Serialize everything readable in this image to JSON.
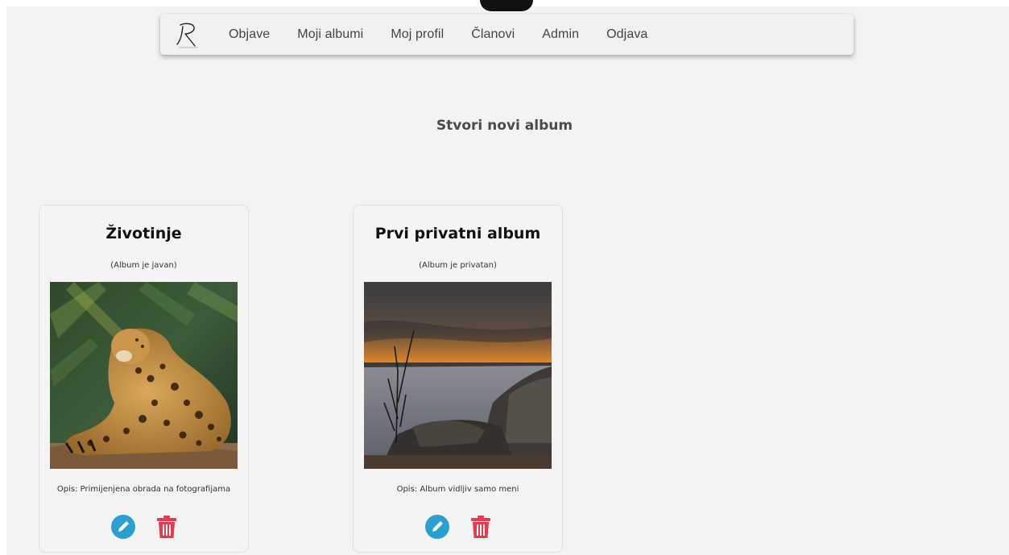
{
  "nav": {
    "logo_icon": "photographer-signature-logo",
    "items": [
      {
        "label": "Objave"
      },
      {
        "label": "Moji albumi"
      },
      {
        "label": "Moj profil"
      },
      {
        "label": "Članovi"
      },
      {
        "label": "Admin"
      },
      {
        "label": "Odjava"
      }
    ]
  },
  "main": {
    "create_album_label": "Stvori novi album"
  },
  "albums": [
    {
      "title": "Životinje",
      "visibility": "(Album je javan)",
      "cover_icon": "jaguar-photo",
      "description": "Opis: Primijenjena obrada na fotografijama"
    },
    {
      "title": "Prvi privatni album",
      "visibility": "(Album je privatan)",
      "cover_icon": "sunset-lake-photo",
      "description": "Opis: Album vidljiv samo meni"
    }
  ],
  "colors": {
    "edit_button": "#2a9fd0",
    "delete_button": "#e8394d",
    "background": "#f3f3f3"
  }
}
